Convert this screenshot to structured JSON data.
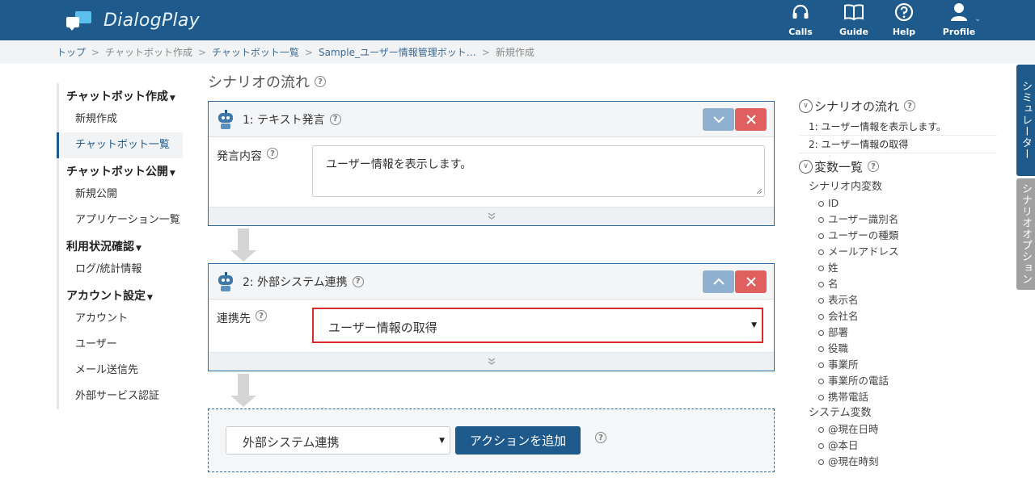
{
  "app": {
    "name": "DialogPlay"
  },
  "header": {
    "nav": [
      {
        "label": "Calls",
        "icon": "headset-icon"
      },
      {
        "label": "Guide",
        "icon": "book-icon"
      },
      {
        "label": "Help",
        "icon": "help-icon"
      },
      {
        "label": "Profile",
        "icon": "user-icon"
      }
    ]
  },
  "breadcrumb": [
    "トップ",
    "チャットボット作成",
    "チャットボット一覧",
    "Sample_ユーザー情報管理ボット…",
    "新規作成"
  ],
  "sidebar": {
    "groups": [
      {
        "title": "チャットボット作成",
        "items": [
          "新規作成",
          "チャットボット一覧"
        ]
      },
      {
        "title": "チャットボット公開",
        "items": [
          "新規公開",
          "アプリケーション一覧"
        ]
      },
      {
        "title": "利用状況確認",
        "items": [
          "ログ/統計情報"
        ]
      },
      {
        "title": "アカウント設定",
        "items": [
          "アカウント",
          "ユーザー",
          "メール送信先",
          "外部サービス認証"
        ]
      }
    ],
    "active_item": "チャットボット一覧"
  },
  "main": {
    "title": "シナリオの流れ",
    "step1": {
      "title": "1: テキスト発言",
      "field_label": "発言内容",
      "text": "ユーザー情報を表示します。"
    },
    "step2": {
      "title": "2: 外部システム連携",
      "field_label": "連携先",
      "selected": "ユーザー情報の取得"
    },
    "add_action": {
      "selected": "外部システム連携",
      "button": "アクションを追加"
    }
  },
  "right_panel": {
    "flow_title": "シナリオの流れ",
    "flow_items": [
      "1: ユーザー情報を表示します。",
      "2: ユーザー情報の取得"
    ],
    "vars_title": "変数一覧",
    "scenario_vars_label": "シナリオ内変数",
    "scenario_vars": [
      "ID",
      "ユーザー識別名",
      "ユーザーの種類",
      "メールアドレス",
      "姓",
      "名",
      "表示名",
      "会社名",
      "部署",
      "役職",
      "事業所",
      "事業所の電話",
      "携帯電話"
    ],
    "system_vars_label": "システム変数",
    "system_vars": [
      "@現在日時",
      "@本日",
      "@現在時刻"
    ]
  },
  "tabs": {
    "simulator": "シミュレーター",
    "scenario_option": "シナリオオプション"
  },
  "colors": {
    "primary": "#1e5a8c",
    "danger": "#e06060",
    "highlight": "#d92b2b"
  }
}
